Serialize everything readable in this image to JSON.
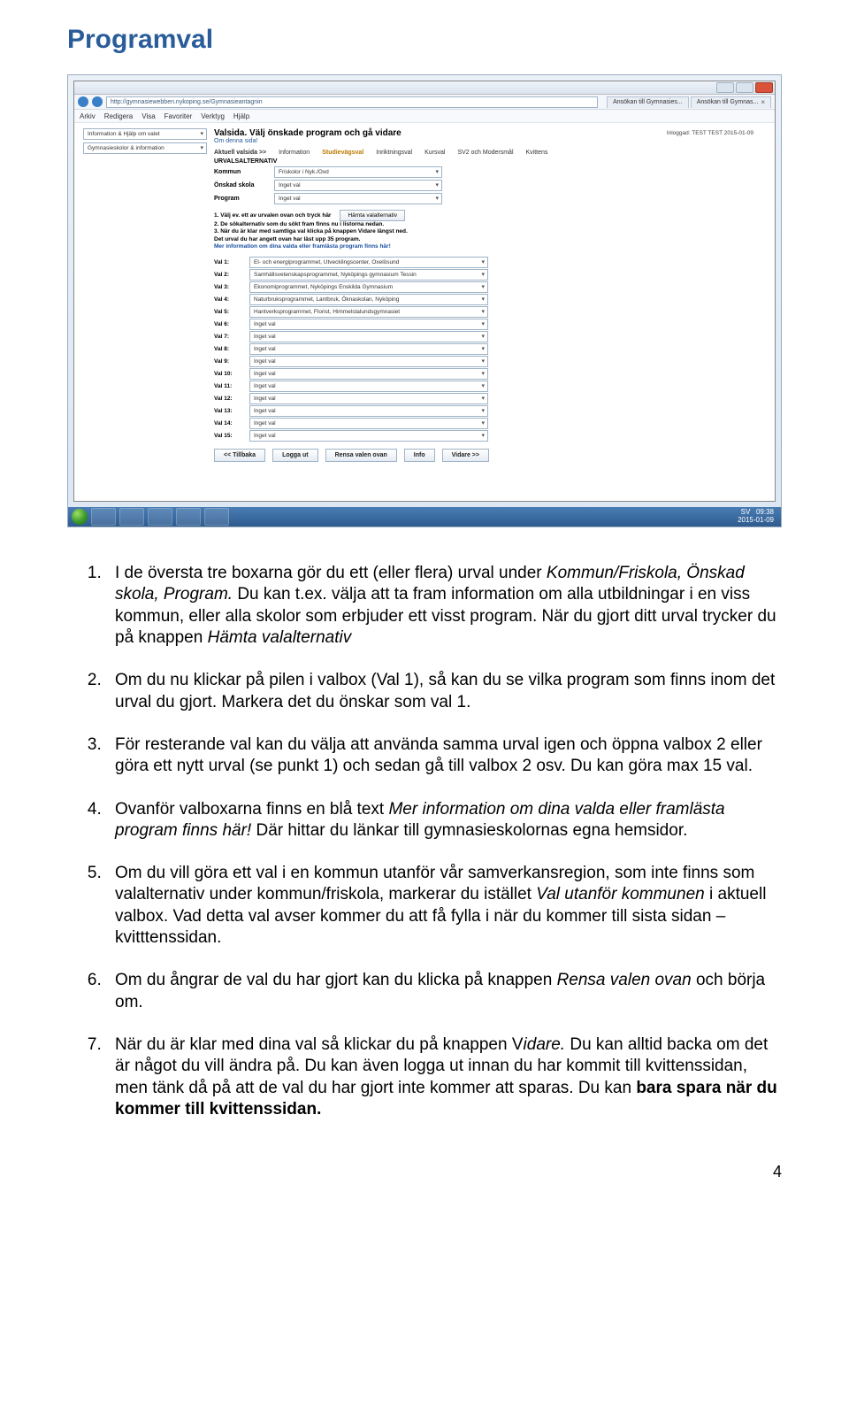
{
  "title": "Programval",
  "browser": {
    "url": "http://gymnasiewebben.nykoping.se/Gymnasieantagnin",
    "tab1": "Ansökan till Gymnasies...",
    "tab2": "Ansökan till Gymnas...",
    "menu": [
      "Arkiv",
      "Redigera",
      "Visa",
      "Favoriter",
      "Verktyg",
      "Hjälp"
    ]
  },
  "window": {
    "min_tip": "Minimize",
    "max_tip": "Maximize",
    "close_tip": "Close"
  },
  "app": {
    "left_help": "Information & Hjälp om valet",
    "left_schools": "Gymnasieskolor & information",
    "heading": "Valsida. Välj önskade program och gå vidare",
    "om": "Om denna sida!",
    "logged": "Inloggad: TEST TEST  2015-01-09",
    "nav": {
      "crumb": "Aktuell valsida >>",
      "items": [
        "Information",
        "Studievägsval",
        "Inriktningsval",
        "Kursval",
        "SV2 och Modersmål",
        "Kvittens"
      ]
    },
    "section": "URVALSALTERNATIV",
    "fields": {
      "kommun_label": "Kommun",
      "kommun_value": "Friskolor i Nyk./Oxd",
      "onskad_label": "Önskad skola",
      "onskad_value": "Inget val",
      "program_label": "Program",
      "program_value": "Inget val"
    },
    "inst": {
      "l1b": "1. Välj ev. ett av urvalen ovan och tryck här",
      "btn": "Hämta valalternativ",
      "l2": "2. De sökalternativ som du sökt fram finns nu i listorna nedan.",
      "l3": "3. När du är klar med samtliga val klicka på knappen Vidare längst ned.",
      "l4": "Det urval du har angett ovan har läst upp 35 program.",
      "l5": "Mer information om dina valda eller framlästa program finns här!"
    },
    "vals": [
      {
        "label": "Val 1:",
        "value": "El- och energiprogrammet, Utvecklingscenter, Oxelösund"
      },
      {
        "label": "Val 2:",
        "value": "Samhällsvetenskapsprogrammet, Nyköpings gymnasium Tessin"
      },
      {
        "label": "Val 3:",
        "value": "Ekonomiprogrammet, Nyköpings Enskilda Gymnasium"
      },
      {
        "label": "Val 4:",
        "value": "Naturbruksprogrammet, Lantbruk, Öknaskolan, Nyköping"
      },
      {
        "label": "Val 5:",
        "value": "Hantverksprogrammet, Florist, Himmelstalundsgymnasiet"
      },
      {
        "label": "Val 6:",
        "value": "Inget val"
      },
      {
        "label": "Val 7:",
        "value": "Inget val"
      },
      {
        "label": "Val 8:",
        "value": "Inget val"
      },
      {
        "label": "Val 9:",
        "value": "Inget val"
      },
      {
        "label": "Val 10:",
        "value": "Inget val"
      },
      {
        "label": "Val 11:",
        "value": "Inget val"
      },
      {
        "label": "Val 12:",
        "value": "Inget val"
      },
      {
        "label": "Val 13:",
        "value": "Inget val"
      },
      {
        "label": "Val 14:",
        "value": "Inget val"
      },
      {
        "label": "Val 15:",
        "value": "Inget val"
      }
    ],
    "buttons": {
      "back": "<< Tillbaka",
      "logout": "Logga ut",
      "clear": "Rensa valen ovan",
      "info": "Info",
      "next": "Vidare >>"
    },
    "task": {
      "lang": "SV",
      "time": "09:38",
      "date": "2015-01-09"
    }
  },
  "list": {
    "i1a": "I de översta tre boxarna gör du ett (eller flera) urval under ",
    "i1b": "Kommun/Friskola, Önskad skola, Program.",
    "i1c": " Du kan t.ex. välja att ta fram information om alla utbildningar i en viss kommun, eller alla skolor som erbjuder ett visst program. När du gjort ditt urval trycker du på knappen ",
    "i1d": "Hämta valalternativ",
    "i2": "Om du nu klickar på pilen i valbox (Val 1), så kan du se vilka program som finns inom det urval du gjort. Markera det du önskar som val 1.",
    "i3": "För resterande val kan du välja att använda samma urval igen och öppna valbox 2 eller göra ett nytt urval (se punkt 1) och sedan gå till valbox 2 osv. Du kan göra max 15 val.",
    "i4a": "Ovanför valboxarna finns en blå text ",
    "i4b": "Mer information om dina valda eller framlästa program finns här!",
    "i4c": " Där hittar du länkar till gymnasieskolornas egna hemsidor.",
    "i5a": "Om du vill göra ett val i en kommun utanför vår samverkansregion, som inte finns som valalternativ under kommun/friskola, markerar du istället ",
    "i5b": "Val utanför kommunen",
    "i5c": " i aktuell valbox. Vad detta val avser kommer du att få fylla i när du kommer till sista sidan – kvitttenssidan.",
    "i6a": "Om du ångrar de val du har gjort kan du klicka på knappen ",
    "i6b": "Rensa valen ovan",
    "i6c": " och börja om.",
    "i7a": "När du är klar med dina val så klickar du på knappen V",
    "i7b": "idare.",
    "i7c": " Du kan alltid backa om det är något du vill ändra på. Du kan även logga ut innan du har kommit till kvittenssidan, men tänk då på att de val du har gjort inte kommer att sparas. Du kan ",
    "i7d": "bara spara när du kommer till kvittenssidan."
  },
  "pagenum": "4"
}
